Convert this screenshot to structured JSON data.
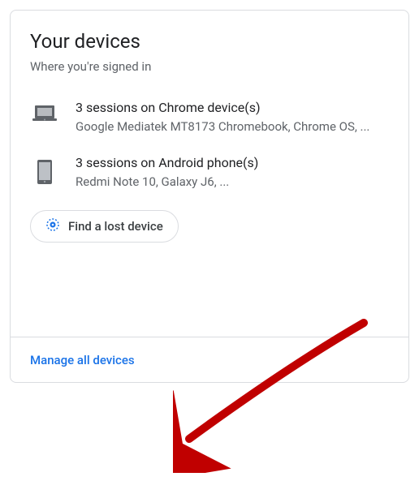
{
  "header": {
    "title": "Your devices",
    "subtitle": "Where you're signed in"
  },
  "devices": [
    {
      "title": "3 sessions on Chrome device(s)",
      "subtitle": "Google Mediatek MT8173 Chromebook, Chrome OS, ..."
    },
    {
      "title": "3 sessions on Android phone(s)",
      "subtitle": "Redmi Note 10, Galaxy J6, ..."
    }
  ],
  "find_device": {
    "label": "Find a lost device"
  },
  "footer": {
    "manage_label": "Manage all devices"
  }
}
